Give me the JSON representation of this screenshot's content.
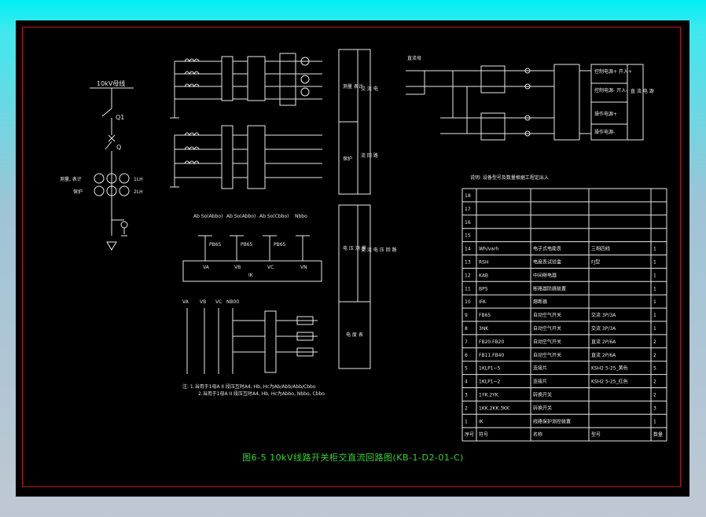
{
  "left": {
    "bus_label": "10kV母线",
    "q1": "Q1",
    "q2": "Q",
    "measure_label": "测量, 表计",
    "protect_label": "保护",
    "ct_label": "1LH",
    "ct2_label": "2LH"
  },
  "upper_mid": {
    "block1_label": "测量 表计",
    "block2_label": "保护",
    "block_v1": "交 流 电",
    "block_v2": "流 回 路"
  },
  "lower_mid": {
    "block1_label": "电 压 测 量",
    "block_v1": "交 流 电 压 回 路",
    "block2_label": "电 度 表"
  },
  "pt_header": [
    "Ab So(Abbo)",
    "Ab So(Abbo)",
    "Ab So(Cbbo)",
    "Nbbo"
  ],
  "pt_labels": [
    "PB65",
    "PB65",
    "PB65"
  ],
  "pt_bus_labels": [
    "VA",
    "VB",
    "VC",
    "VN"
  ],
  "pt_box_label": "IK",
  "rel_header": [
    "VA",
    "VB",
    "VC",
    "NB00"
  ],
  "notes": [
    "注: 1.当用于1母A II 段压互时A4, Hb, Hc为Ab/Abb/Abb/Cbbo",
    "2.当用于1母A II 段压互时A4, Hb, Hc为Abbo, Nbbo, Cbbo"
  ],
  "dc": {
    "bus_label": "直流母",
    "vertical": "直 流 电 源",
    "items": [
      "控制电源+ 开入+",
      "控制电源- 开入-",
      "操作电源+",
      "操作电源-"
    ]
  },
  "table_note": "说明: 设备型号及数量根据工程定出入",
  "table": {
    "headers": [
      "序号",
      "符号",
      "名称",
      "型号",
      "数量"
    ],
    "rows": [
      [
        "18",
        "",
        "",
        "",
        ""
      ],
      [
        "17",
        "",
        "",
        "",
        ""
      ],
      [
        "16",
        "",
        "",
        "",
        ""
      ],
      [
        "15",
        "",
        "",
        "",
        ""
      ],
      [
        "14",
        "Wh/varh",
        "电子式电能表",
        "三相四线",
        "1"
      ],
      [
        "13",
        "RSH",
        "电度表试验盒",
        "FJ型",
        "1"
      ],
      [
        "12",
        "KAB",
        "中间继电器",
        "",
        "1"
      ],
      [
        "11",
        "BPS",
        "断路器防跳装置",
        "",
        "1"
      ],
      [
        "10",
        "IFA",
        "熔断器",
        "",
        "1"
      ],
      [
        "9",
        "FB65",
        "自动空气开关",
        "交流 3P/3A",
        "1"
      ],
      [
        "8",
        "3NK",
        "自动空气开关",
        "交流 3P/3A",
        "1"
      ],
      [
        "7",
        "FB20.FB20",
        "自动空气开关",
        "直流 2P/6A",
        "2"
      ],
      [
        "6",
        "FB11.FB40",
        "自动空气开关",
        "直流 2P/6A",
        "2"
      ],
      [
        "5",
        "1KLP1~5",
        "连接片",
        "KSH2 5-25_黄色",
        "5"
      ],
      [
        "4",
        "1KLP1~2",
        "连接片",
        "KSH2 5-25_红色",
        "2"
      ],
      [
        "3",
        "1YK.2YK",
        "转换开关",
        "",
        "2"
      ],
      [
        "2",
        "1KK.2KK.3KK",
        "转换开关",
        "",
        "3"
      ],
      [
        "1",
        "IK",
        "线路保护测控装置",
        "",
        "1"
      ]
    ]
  },
  "caption": "图6-5 10kV线路开关柜交直流回路图(KB-1-D2-01-C)",
  "colors": {
    "background": "#000000",
    "frame": "#c01818",
    "caption": "#2fd82f",
    "lines": "#e8e8e8"
  }
}
